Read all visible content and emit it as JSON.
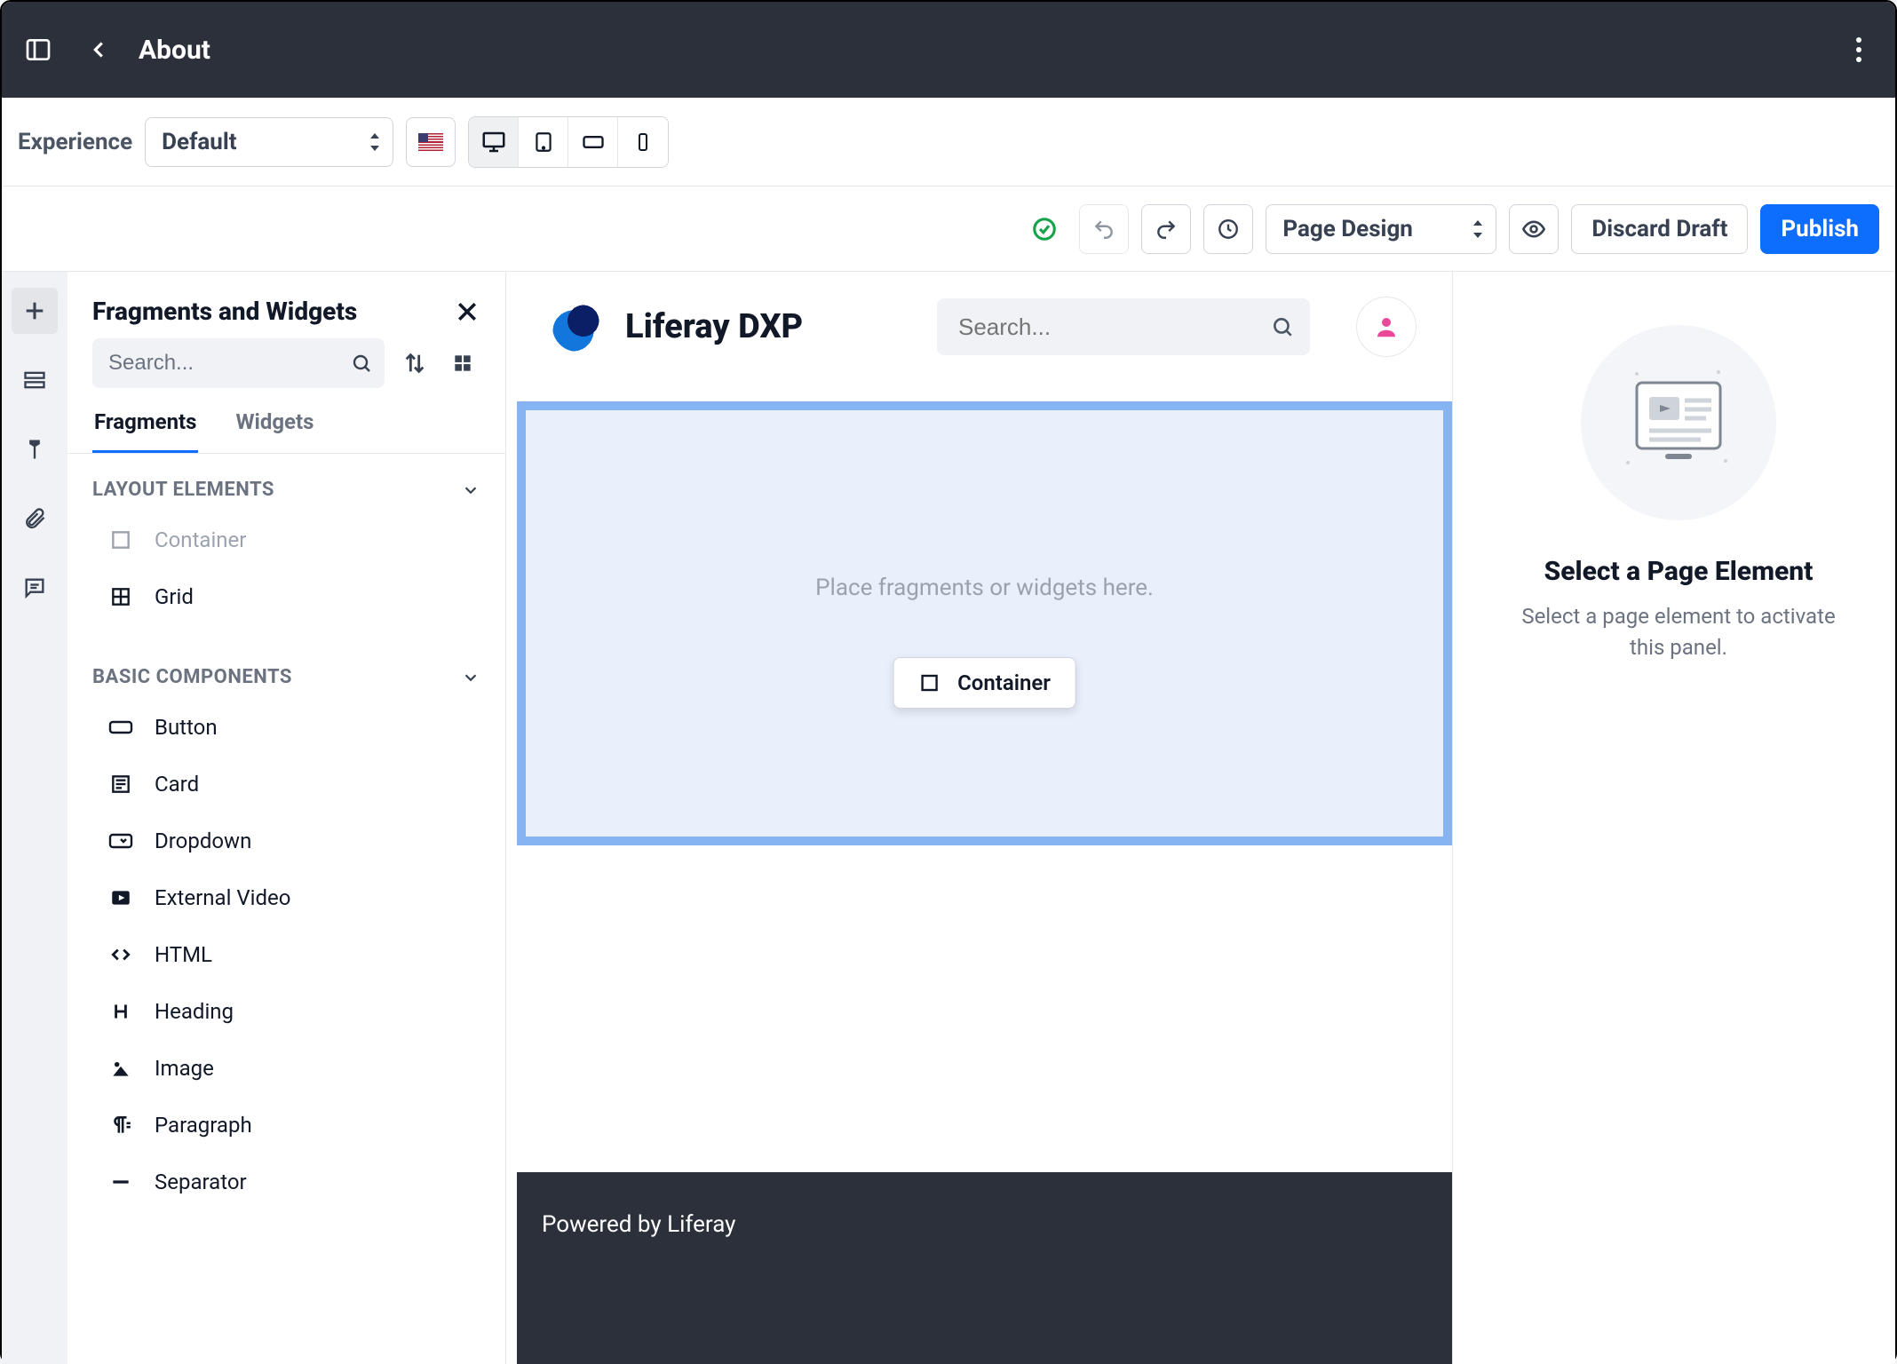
{
  "topbar": {
    "title": "About"
  },
  "experience": {
    "label": "Experience",
    "value": "Default"
  },
  "mode_select": "Page Design",
  "buttons": {
    "discard": "Discard Draft",
    "publish": "Publish"
  },
  "panel": {
    "title": "Fragments and Widgets",
    "search_placeholder": "Search...",
    "tabs": {
      "fragments": "Fragments",
      "widgets": "Widgets"
    },
    "groups": {
      "layout": {
        "title": "LAYOUT ELEMENTS",
        "items": {
          "container": "Container",
          "grid": "Grid"
        }
      },
      "basic": {
        "title": "BASIC COMPONENTS",
        "items": {
          "button": "Button",
          "card": "Card",
          "dropdown": "Dropdown",
          "external_video": "External Video",
          "html": "HTML",
          "heading": "Heading",
          "image": "Image",
          "paragraph": "Paragraph",
          "separator": "Separator"
        }
      }
    }
  },
  "canvas": {
    "site_title": "Liferay DXP",
    "site_search_placeholder": "Search...",
    "drop_text": "Place fragments or widgets here.",
    "drag_chip": "Container",
    "footer": "Powered by Liferay"
  },
  "right": {
    "title": "Select a Page Element",
    "sub": "Select a page element to activate this panel."
  }
}
